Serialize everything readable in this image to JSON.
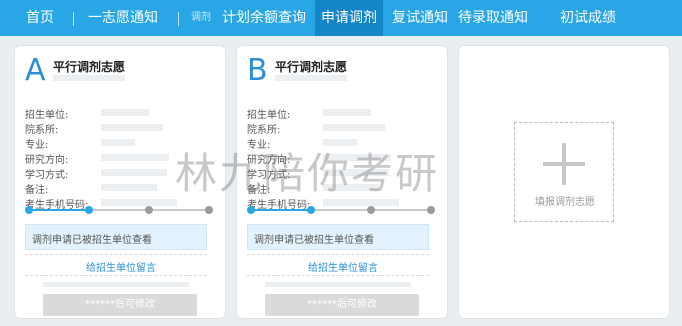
{
  "nav": {
    "items": [
      {
        "label": "首页"
      },
      {
        "label": "一志愿通知"
      },
      {
        "label": "调剂"
      },
      {
        "label": "计划余额查询"
      },
      {
        "label": "申请调剂"
      },
      {
        "label": "复试通知"
      },
      {
        "label": "待录取通知"
      },
      {
        "label": "初试成绩"
      }
    ],
    "active_index": 4
  },
  "cards": [
    {
      "letter": "A",
      "title": "平行调剂志愿",
      "fields": [
        "招生单位:",
        "院系所:",
        "专业:",
        "研究方向:",
        "学习方式:",
        "备注:",
        "考生手机号码:"
      ],
      "progress": {
        "steps": 4,
        "current": 2
      },
      "notice": "调剂申请已被招生单位查看",
      "link": "给招生单位留言",
      "button": "******后可修改"
    },
    {
      "letter": "B",
      "title": "平行调剂志愿",
      "fields": [
        "招生单位:",
        "院系所:",
        "专业:",
        "研究方向:",
        "学习方式:",
        "备注:",
        "考生手机号码:"
      ],
      "progress": {
        "steps": 4,
        "current": 2
      },
      "notice": "调剂申请已被招生单位查看",
      "link": "给招生单位留言",
      "button": "******后可修改"
    }
  ],
  "add_card": {
    "label": "填报调剂志愿",
    "icon": "plus-icon"
  },
  "watermark": "林九陪你考研",
  "colors": {
    "accent": "#29a6e6",
    "nav_active": "#1486c8",
    "link": "#2d8fd8"
  }
}
